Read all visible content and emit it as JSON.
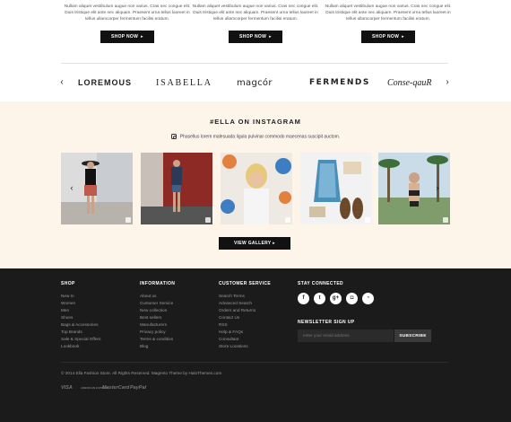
{
  "promos": [
    {
      "text": "Nullam aliquet vestibulum augue non varius. Cras nec congue elit. Duis tristique elit ante nec aliquam. Praesent urna tellus laoreet in tellus ullamcorper fermentum facilisi eratum.",
      "button": "SHOP NOW"
    },
    {
      "text": "Nullam aliquet vestibulum augue non varius. Cras nec congue elit. Duis tristique elit ante nec aliquam. Praesent urna tellus laoreet in tellus ullamcorper fermentum facilisi eratum.",
      "button": "SHOP NOW"
    },
    {
      "text": "Nullam aliquet vestibulum augue non varius. Cras nec congue elit. Duis tristique elit ante nec aliquam. Praesent urna tellus laoreet in tellus ullamcorper fermentum facilisi eratum.",
      "button": "SHOP NOW"
    }
  ],
  "brands": [
    "LOREMOUS",
    "ISABELLA",
    "magcór",
    "FERMENDS",
    "Conse-qauR"
  ],
  "instagram": {
    "title": "#ELLA ON INSTAGRAM",
    "subtitle": "Phasellus lorem malesuada ligula pulvinar commodo maecenas suscipit auctom.",
    "view_button": "VIEW GALLERY"
  },
  "footer": {
    "shop": {
      "heading": "SHOP",
      "items": [
        "New In",
        "Women",
        "Men",
        "Shoes",
        "Bags & Accessories",
        "Top Brands",
        "Sale & Special Offers",
        "Lookbook"
      ]
    },
    "information": {
      "heading": "INFORMATION",
      "items": [
        "About us",
        "Customer Service",
        "New collection",
        "Best sellers",
        "Manufacturers",
        "Privacy policy",
        "Terms & condition",
        "Blog"
      ]
    },
    "customer_service": {
      "heading": "CUSTOMER SERVICE",
      "items": [
        "Search Terms",
        "Advanced Search",
        "Orders and Returns",
        "Contact Us",
        "RSS",
        "Help & FAQs",
        "Consultant",
        "Store Locations"
      ]
    },
    "stay_connected": "STAY CONNECTED",
    "newsletter": {
      "heading": "NEWSLETTER SIGN UP",
      "placeholder": "enter your email address",
      "button": "SUBSCRIBE"
    },
    "copyright": "© 2014 Ella Fashion Store. All Rights Reserved. Magento Theme by HaloThemes.com",
    "payments": [
      "VISA",
      "AMERICAN EXPRESS",
      "MasterCard",
      "PayPal"
    ]
  },
  "icons": {
    "prev": "chevron-left-icon",
    "next": "chevron-right-icon",
    "social": [
      "facebook-icon",
      "twitter-icon",
      "google-plus-icon",
      "instagram-icon",
      "rss-icon"
    ]
  },
  "colors": {
    "accent": "#111111",
    "instagram_bg": "#fdf4ea",
    "footer_bg": "#1b1b1b"
  }
}
